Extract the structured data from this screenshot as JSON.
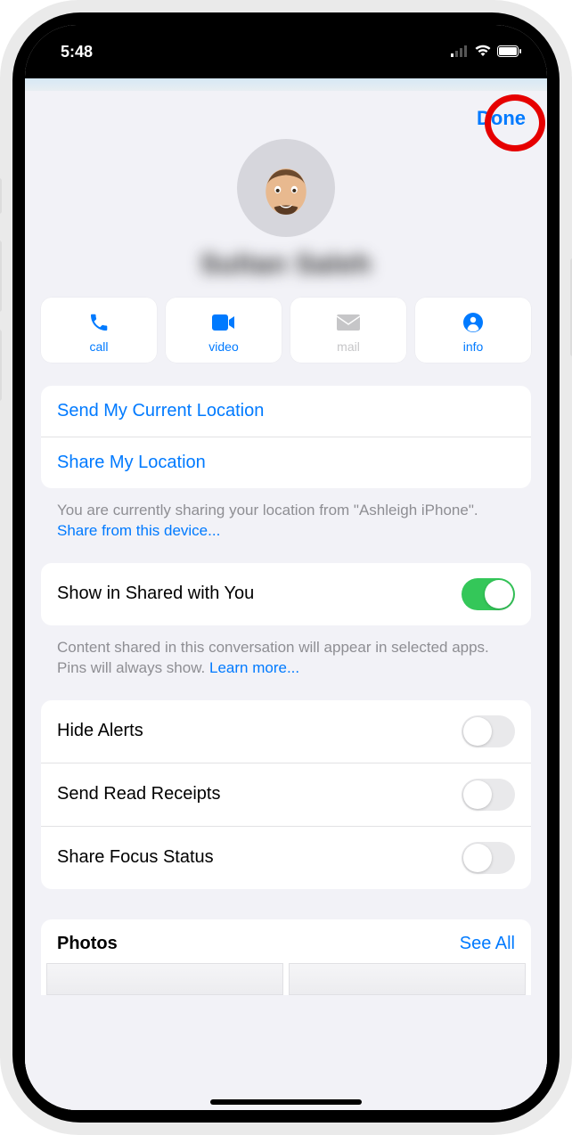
{
  "status": {
    "time": "5:48"
  },
  "header": {
    "done": "Done"
  },
  "contact": {
    "name": "Sultan Saleh"
  },
  "actions": {
    "call": "call",
    "video": "video",
    "mail": "mail",
    "info": "info"
  },
  "location": {
    "send_current": "Send My Current Location",
    "share": "Share My Location",
    "footer_pre": "You are currently sharing your location from \"Ashleigh iPhone\". ",
    "footer_link": "Share from this device..."
  },
  "shared_with_you": {
    "label": "Show in Shared with You",
    "footer_pre": "Content shared in this conversation will appear in selected apps. Pins will always show. ",
    "footer_link": "Learn more..."
  },
  "settings": {
    "hide_alerts": "Hide Alerts",
    "send_read_receipts": "Send Read Receipts",
    "share_focus_status": "Share Focus Status"
  },
  "photos": {
    "title": "Photos",
    "see_all": "See All"
  }
}
